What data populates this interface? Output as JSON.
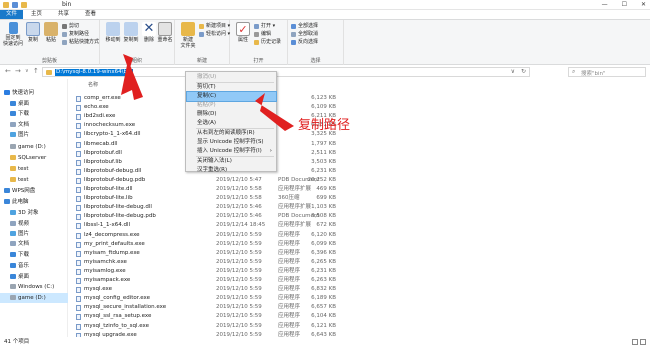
{
  "window": {
    "title": "bin",
    "minimize": "—",
    "maximize": "☐",
    "close": "✕"
  },
  "ribbon_tabs": [
    "文件",
    "主页",
    "共享",
    "查看"
  ],
  "ribbon": {
    "pin_label": "固定到\n快速访问",
    "copy_label": "复制",
    "paste_label": "粘贴",
    "cut_label": "剪切",
    "copy_path_label": "复制路径",
    "paste_shortcut_label": "粘贴快捷方式",
    "move_to_label": "移动到",
    "copy_to_label": "复制到",
    "delete_label": "删除",
    "rename_label": "重命名",
    "new_folder_label": "新建\n文件夹",
    "new_item_label": "新建项目 ▾",
    "easy_access_label": "轻松访问 ▾",
    "properties_label": "属性",
    "open_label": "打开 ▾",
    "edit_label": "编辑",
    "history_label": "历史记录",
    "select_all_label": "全部选择",
    "select_none_label": "全部取消",
    "invert_label": "反向选择",
    "group_clipboard": "剪贴板",
    "group_organize": "组织",
    "group_new": "新建",
    "group_open": "打开",
    "group_select": "选择"
  },
  "address": {
    "path": "D:\\mysql-8.0.19-winx64\\bin",
    "back": "←",
    "forward": "→",
    "up": "↑",
    "recent": "∨"
  },
  "search": {
    "placeholder": "搜索\"bin\"",
    "icon": "search-icon"
  },
  "sidebar": {
    "items": [
      {
        "label": "快速访问",
        "icon": "star-icon",
        "color": "#2b7de1"
      },
      {
        "label": "桌面",
        "icon": "desktop-icon",
        "color": "#3a86d9"
      },
      {
        "label": "下载",
        "icon": "download-icon",
        "color": "#3a86d9"
      },
      {
        "label": "文档",
        "icon": "document-icon",
        "color": "#8fa4bf"
      },
      {
        "label": "图片",
        "icon": "picture-icon",
        "color": "#4fa3e0"
      },
      {
        "label": "game (D:)",
        "icon": "drive-icon",
        "color": "#9aa5b1"
      },
      {
        "label": "SQLserver",
        "icon": "folder-icon",
        "color": "#e8b84a"
      },
      {
        "label": "test",
        "icon": "folder-icon",
        "color": "#e8b84a"
      },
      {
        "label": "test",
        "icon": "folder-icon",
        "color": "#e8b84a"
      },
      {
        "label": "WPS网盘",
        "icon": "cloud-icon",
        "color": "#3a86d9"
      },
      {
        "label": "此电脑",
        "icon": "computer-icon",
        "color": "#3a86d9"
      },
      {
        "label": "3D 对象",
        "icon": "cube-icon",
        "color": "#4fa3e0"
      },
      {
        "label": "视频",
        "icon": "video-icon",
        "color": "#8fa4bf"
      },
      {
        "label": "图片",
        "icon": "picture-icon",
        "color": "#4fa3e0"
      },
      {
        "label": "文档",
        "icon": "document-icon",
        "color": "#8fa4bf"
      },
      {
        "label": "下载",
        "icon": "download-icon",
        "color": "#3a86d9"
      },
      {
        "label": "音乐",
        "icon": "music-icon",
        "color": "#3a86d9"
      },
      {
        "label": "桌面",
        "icon": "desktop-icon",
        "color": "#3a86d9"
      },
      {
        "label": "Windows (C:)",
        "icon": "drive-icon",
        "color": "#9aa5b1"
      },
      {
        "label": "game (D:)",
        "icon": "drive-icon",
        "color": "#9aa5b1"
      }
    ]
  },
  "columns": {
    "name": "名称",
    "date": "修改日期",
    "type": "类型",
    "size": "大小"
  },
  "files": [
    {
      "name": "comp_err.exe",
      "date": "",
      "type": "",
      "size": "6,123 KB"
    },
    {
      "name": "echo.exe",
      "date": "",
      "type": "",
      "size": "6,109 KB"
    },
    {
      "name": "ibd2sdi.exe",
      "date": "",
      "type": "",
      "size": "6,211 KB"
    },
    {
      "name": "innochecksum.exe",
      "date": "",
      "type": "",
      "size": "6,231 KB"
    },
    {
      "name": "libcrypto-1_1-x64.dll",
      "date": "",
      "type": "",
      "size": "3,325 KB"
    },
    {
      "name": "libmecab.dll",
      "date": "",
      "type": "",
      "size": "1,797 KB"
    },
    {
      "name": "libprotobuf.dll",
      "date": "",
      "type": "",
      "size": "2,511 KB"
    },
    {
      "name": "libprotobuf.lib",
      "date": "",
      "type": "",
      "size": "3,503 KB"
    },
    {
      "name": "libprotobuf-debug.dll",
      "date": "",
      "type": "",
      "size": "6,231 KB"
    },
    {
      "name": "libprotobuf-debug.pdb",
      "date": "2019/12/10 5:47",
      "type": "PDB Document",
      "size": "20,252 KB"
    },
    {
      "name": "libprotobuf-lite.dll",
      "date": "2019/12/10 5:58",
      "type": "应用程序扩展",
      "size": "469 KB"
    },
    {
      "name": "libprotobuf-lite.lib",
      "date": "2019/12/10 5:58",
      "type": "360压缩",
      "size": "699 KB"
    },
    {
      "name": "libprotobuf-lite-debug.dll",
      "date": "2019/12/10 5:46",
      "type": "应用程序扩展",
      "size": "1,103 KB"
    },
    {
      "name": "libprotobuf-lite-debug.pdb",
      "date": "2019/12/10 5:46",
      "type": "PDB Document",
      "size": "3,508 KB"
    },
    {
      "name": "libssl-1_1-x64.dll",
      "date": "2019/12/14 18:45",
      "type": "应用程序扩展",
      "size": "672 KB"
    },
    {
      "name": "lz4_decompress.exe",
      "date": "2019/12/10 5:59",
      "type": "应用程序",
      "size": "6,120 KB"
    },
    {
      "name": "my_print_defaults.exe",
      "date": "2019/12/10 5:59",
      "type": "应用程序",
      "size": "6,099 KB"
    },
    {
      "name": "myisam_ftdump.exe",
      "date": "2019/12/10 5:59",
      "type": "应用程序",
      "size": "6,396 KB"
    },
    {
      "name": "myisamchk.exe",
      "date": "2019/12/10 5:59",
      "type": "应用程序",
      "size": "6,265 KB"
    },
    {
      "name": "myisamlog.exe",
      "date": "2019/12/10 5:59",
      "type": "应用程序",
      "size": "6,231 KB"
    },
    {
      "name": "myisampack.exe",
      "date": "2019/12/10 5:59",
      "type": "应用程序",
      "size": "6,263 KB"
    },
    {
      "name": "mysql.exe",
      "date": "2019/12/10 5:59",
      "type": "应用程序",
      "size": "6,832 KB"
    },
    {
      "name": "mysql_config_editor.exe",
      "date": "2019/12/10 5:59",
      "type": "应用程序",
      "size": "6,189 KB"
    },
    {
      "name": "mysql_secure_installation.exe",
      "date": "2019/12/10 5:59",
      "type": "应用程序",
      "size": "6,657 KB"
    },
    {
      "name": "mysql_ssl_rsa_setup.exe",
      "date": "2019/12/10 5:59",
      "type": "应用程序",
      "size": "6,104 KB"
    },
    {
      "name": "mysql_tzinfo_to_sql.exe",
      "date": "2019/12/10 5:59",
      "type": "应用程序",
      "size": "6,121 KB"
    },
    {
      "name": "mysql upgrade.exe",
      "date": "2019/12/10 5:59",
      "type": "应用程序",
      "size": "6,643 KB"
    }
  ],
  "context_menu": {
    "items": [
      {
        "label": "撤消(U)",
        "disabled": true
      },
      {
        "label": "剪切(T)",
        "disabled": false
      },
      {
        "label": "复制(C)",
        "disabled": false,
        "highlighted": true
      },
      {
        "label": "粘贴(P)",
        "disabled": true
      },
      {
        "label": "删除(D)",
        "disabled": false
      },
      {
        "label": "全选(A)",
        "disabled": false
      },
      {
        "label": "从右到左的阅读顺序(R)",
        "disabled": false
      },
      {
        "label": "显示 Unicode 控制字符(S)",
        "disabled": false
      },
      {
        "label": "插入 Unicode 控制字符(I)",
        "disabled": false,
        "submenu": true
      },
      {
        "label": "关闭输入法(L)",
        "disabled": false
      },
      {
        "label": "汉字重选(R)",
        "disabled": false
      }
    ]
  },
  "annotation": {
    "text": "复制路径",
    "color": "#e02020"
  },
  "status": {
    "count": "41 个项目"
  },
  "colors": {
    "file_tab": "#1979ca",
    "selection": "#0078d7",
    "highlight": "#91c9f7"
  }
}
